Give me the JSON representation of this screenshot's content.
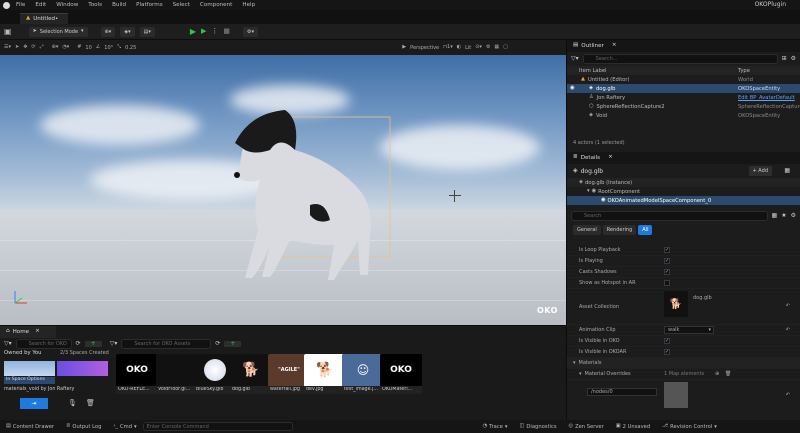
{
  "menu": {
    "items": [
      "File",
      "Edit",
      "Window",
      "Tools",
      "Build",
      "Platforms",
      "Select",
      "Component",
      "Help"
    ],
    "project": "OKOPlugin"
  },
  "tabs": {
    "level": "Untitled•"
  },
  "toolbar": {
    "mode": "Selection Mode",
    "grid": "10",
    "angle": "10°",
    "scale": "0.25"
  },
  "viewport": {
    "view": "Perspective",
    "lit": "Lit",
    "watermark": "OKO"
  },
  "outliner": {
    "title": "Outliner",
    "search_placeholder": "Search...",
    "col_label": "Item Label",
    "col_type": "Type",
    "rows": [
      {
        "label": "Untitled (Editor)",
        "type": "World"
      },
      {
        "label": "dog.glb",
        "type": "OKOSpaceEntity"
      },
      {
        "label": "Jon Raftery",
        "type": "Edit BP_AvatarDefault"
      },
      {
        "label": "SphereReflectionCapture2",
        "type": "SphereReflectionCapture"
      },
      {
        "label": "Void",
        "type": "OKOSpaceEntity"
      }
    ],
    "count": "4 actors (1 selected)"
  },
  "details": {
    "title": "Details",
    "object": "dog.glb",
    "add": "+ Add",
    "instance": "dog.glb (Instance)",
    "root": "RootComponent",
    "component": "OKOAnimatedModelSpaceComponent_0",
    "search_placeholder": "Search",
    "filters": [
      "General",
      "Rendering",
      "All"
    ],
    "props": [
      "Is Loop Playback",
      "Is Playing",
      "Casts Shadows",
      "Show as Hotspot in AR"
    ],
    "asset_label": "Asset Collection",
    "asset_value": "dog.glb",
    "anim_label": "Animation Clip",
    "anim_value": "walk",
    "vis_oko": "Is Visible in OKO",
    "vis_okoar": "Is Visible in OKOAR",
    "materials": "Materials",
    "mat_over": "Material Overrides",
    "mat_count": "1 Map elements",
    "mat_node": "/nodes/0"
  },
  "content": {
    "tab": "Home",
    "search1": "Search for OKO",
    "search2": "Search for OKO Assets",
    "owned": "Owned by You",
    "spaces": "2/3 Spaces Created",
    "inspace": "In Space Options",
    "user": "materials_void by Jon Raftery",
    "assets": [
      "OKO-REFLE...",
      "VoidFloor.gl...",
      "BlueSky.glb",
      "dog.glb",
      "waterfall.jpg",
      "dev.jpg",
      "test_image.j...",
      "OKOMateri..."
    ]
  },
  "status": {
    "drawer": "Content Drawer",
    "log": "Output Log",
    "cmd": "Cmd",
    "console": "Enter Console Command",
    "trace": "Trace",
    "diag": "Diagnostics",
    "zen": "Zen Server",
    "unsaved": "2 Unsaved",
    "rev": "Revision Control"
  }
}
